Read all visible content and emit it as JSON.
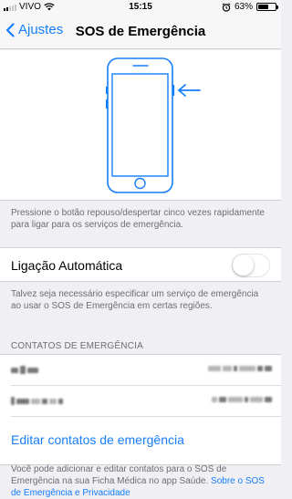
{
  "status_bar": {
    "carrier": "VIVO",
    "time": "15:15",
    "battery_percent": "63%",
    "battery_level": 0.63,
    "signal_bars_on": 2,
    "signal_bars_total": 5
  },
  "nav": {
    "back_label": "Ajustes",
    "title": "SOS de Emergência"
  },
  "illustration": {
    "caption": "Pressione o botão repouso/despertar cinco vezes rapidamente para ligar para os serviços de emergência.",
    "accent_color": "#157efb"
  },
  "auto_call": {
    "label": "Ligação Automática",
    "enabled": false,
    "footer": "Talvez seja necessário especificar um serviço de emergência ao usar o SOS de Emergência em certas regiões."
  },
  "contacts": {
    "section_header": "CONTATOS DE EMERGÊNCIA",
    "items": [
      {
        "name": "",
        "phone": ""
      },
      {
        "name": "",
        "phone": ""
      }
    ],
    "edit_label": "Editar contatos de emergência",
    "footer_text": "Você pode adicionar e editar contatos para o SOS de Emergência na sua Ficha Médica no app Saúde.",
    "footer_link": "Sobre o SOS de Emergência e Privacidade"
  },
  "colors": {
    "accent": "#157efb",
    "background": "#efeff4",
    "secondary_text": "#6d6d72"
  }
}
